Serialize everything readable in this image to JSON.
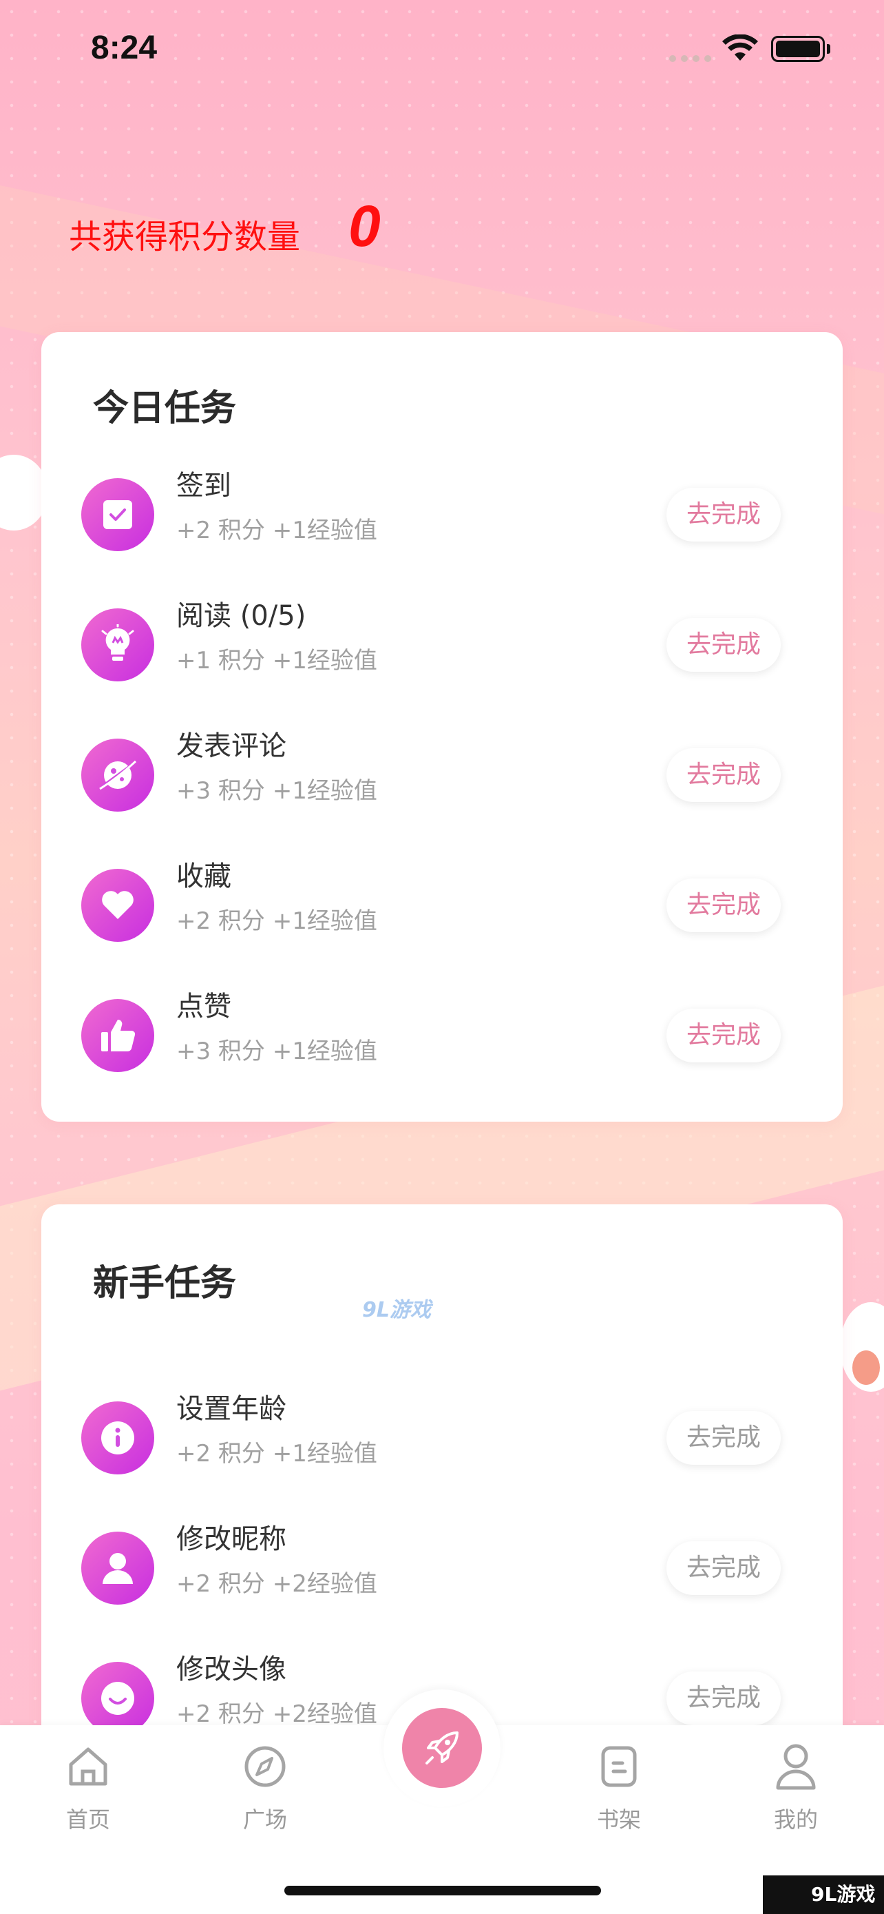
{
  "status_bar": {
    "time": "8:24"
  },
  "header": {
    "points_label": "共获得积分数量",
    "points_value": "0"
  },
  "daily": {
    "title": "今日任务",
    "tasks": [
      {
        "name": "签到",
        "reward": "+2 积分 +1经验值",
        "button": "去完成",
        "icon": "checkbox-icon"
      },
      {
        "name": "阅读 (0/5)",
        "reward": "+1 积分 +1经验值",
        "button": "去完成",
        "icon": "lightbulb-icon"
      },
      {
        "name": "发表评论",
        "reward": "+3 积分 +1经验值",
        "button": "去完成",
        "icon": "planet-icon"
      },
      {
        "name": "收藏",
        "reward": "+2 积分 +1经验值",
        "button": "去完成",
        "icon": "heart-icon"
      },
      {
        "name": "点赞",
        "reward": "+3 积分 +1经验值",
        "button": "去完成",
        "icon": "thumbs-up-icon"
      }
    ]
  },
  "newbie": {
    "title": "新手任务",
    "tasks": [
      {
        "name": "设置年龄",
        "reward": "+2 积分 +1经验值",
        "button": "去完成",
        "icon": "info-icon"
      },
      {
        "name": "修改昵称",
        "reward": "+2 积分 +2经验值",
        "button": "去完成",
        "icon": "user-icon"
      },
      {
        "name": "修改头像",
        "reward": "+2 积分 +2经验值",
        "button": "去完成",
        "icon": "smile-icon"
      }
    ]
  },
  "watermark": "9L游戏",
  "corner_logo": "9L游戏",
  "tabbar": {
    "tabs": [
      {
        "label": "首页",
        "icon": "home-icon"
      },
      {
        "label": "广场",
        "icon": "compass-icon"
      },
      {
        "label": "书架",
        "icon": "bookshelf-icon"
      },
      {
        "label": "我的",
        "icon": "profile-icon"
      }
    ],
    "center_icon": "rocket-icon"
  },
  "colors": {
    "accent_pink": "#ef84a9",
    "icon_gradient_start": "#f06ad0",
    "icon_gradient_end": "#c82fe0",
    "points_red": "#ff1010"
  }
}
